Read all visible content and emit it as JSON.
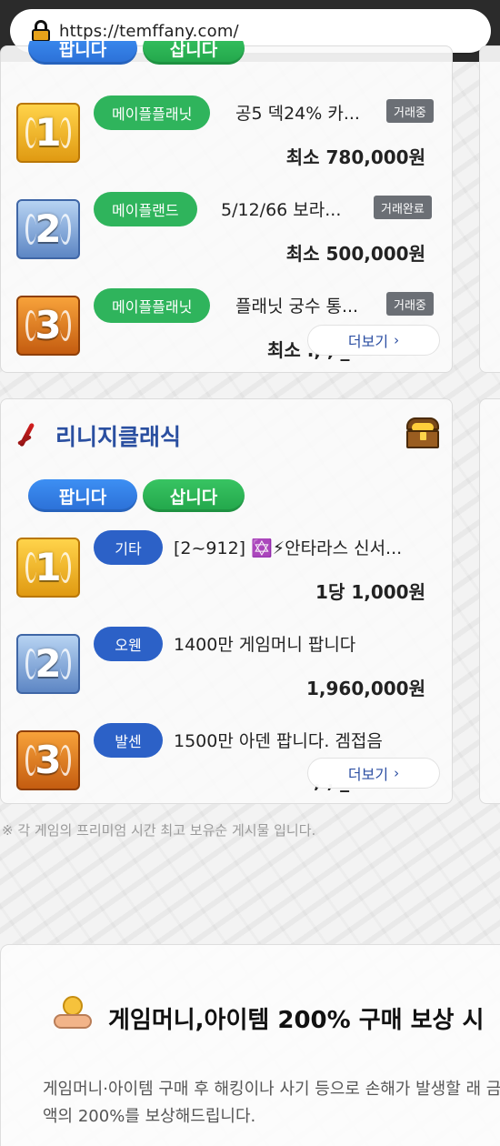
{
  "browser": {
    "url": "https://temffany.com/"
  },
  "card1": {
    "tabs": {
      "sell": "팝니다",
      "buy": "삽니다"
    },
    "items": [
      {
        "rank": "1",
        "category": "메이플플래닛",
        "title": "공5 덱24% 카...",
        "status": "거래중",
        "price": "최소 780,000원"
      },
      {
        "rank": "2",
        "category": "메이플랜드",
        "title": "5/12/66 보라...",
        "status": "거래완료",
        "price": "최소 500,000원"
      },
      {
        "rank": "3",
        "category": "메이플플래닛",
        "title": "플래닛 궁수 통...",
        "status": "거래중",
        "price": "최소 ., , _"
      }
    ],
    "more": "더보기"
  },
  "card2": {
    "game": "리니지클래식",
    "tabs": {
      "sell": "팝니다",
      "buy": "삽니다"
    },
    "items": [
      {
        "rank": "1",
        "category": "기타",
        "title": "[2~912] ✡️⚡안타라스 신서...",
        "price": "1당 1,000원"
      },
      {
        "rank": "2",
        "category": "오웬",
        "title": "1400만 게임머니 팝니다",
        "price": "1,960,000원"
      },
      {
        "rank": "3",
        "category": "발센",
        "title": "1500만 아덴 팝니다. 겜접음",
        "price": ", , _"
      }
    ],
    "more": "더보기"
  },
  "notice": "※ 각 게임의 프리미엄 시간 최고 보유순 게시물 입니다.",
  "promo": {
    "title": "게임머니,아이템 200% 구매 보상 시",
    "text": "게임머니·아이템 구매 후 해킹이나 사기 등으로 손해가 발생할 래 금액의 200%를 보상해드립니다."
  }
}
